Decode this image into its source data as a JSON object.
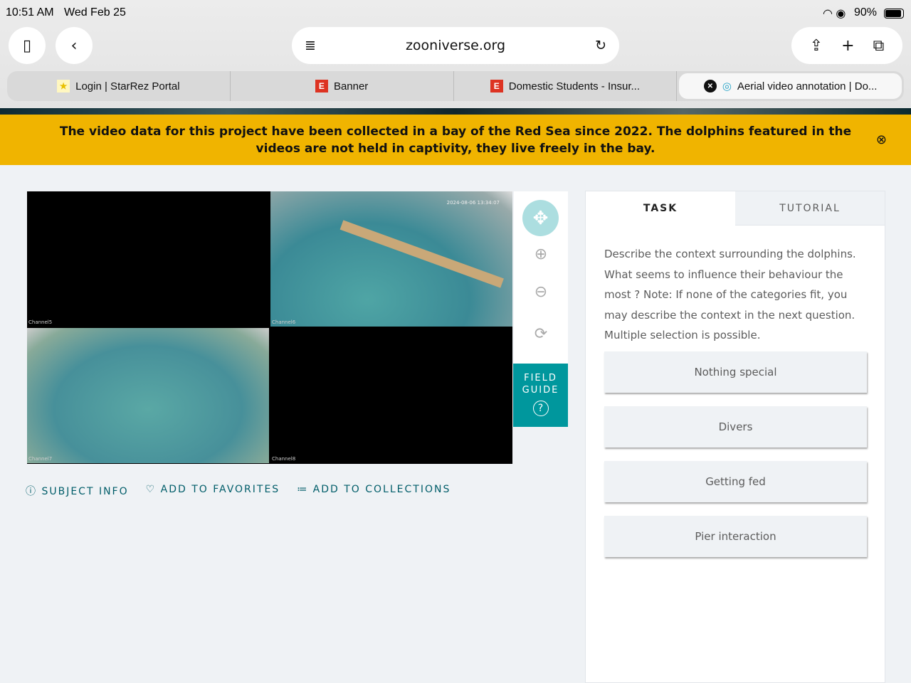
{
  "status": {
    "time": "10:51 AM",
    "date": "Wed Feb 25",
    "battery": "90%"
  },
  "browser": {
    "url": "zooniverse.org",
    "tabs": [
      {
        "title": "Login | StarRez Portal"
      },
      {
        "title": "Banner"
      },
      {
        "title": "Domestic Students - Insur..."
      },
      {
        "title": "Aerial video annotation | Do..."
      }
    ]
  },
  "banner": {
    "text": "The video data for this project have been collected in a bay of the Red Sea since 2022. The dolphins featured in the videos are not held in captivity, they live freely in the bay."
  },
  "video": {
    "timestamp": "2024-08-06 13:34:07",
    "channels": [
      "Channel5",
      "Channel6",
      "Channel7",
      "Channel8"
    ]
  },
  "field_guide": {
    "line1": "FIELD",
    "line2": "GUIDE"
  },
  "links": {
    "info": "SUBJECT INFO",
    "fav": "ADD TO FAVORITES",
    "coll": "ADD TO COLLECTIONS"
  },
  "panel": {
    "tabs": [
      "TASK",
      "TUTORIAL"
    ],
    "instruction": "Describe the context surrounding the dolphins. What seems to influence their behaviour the most ? Note: If none of the categories fit, you may describe the context in the next question. Multiple selection is possible.",
    "answers": [
      "Nothing special",
      "Divers",
      "Getting fed",
      "Pier interaction"
    ]
  }
}
